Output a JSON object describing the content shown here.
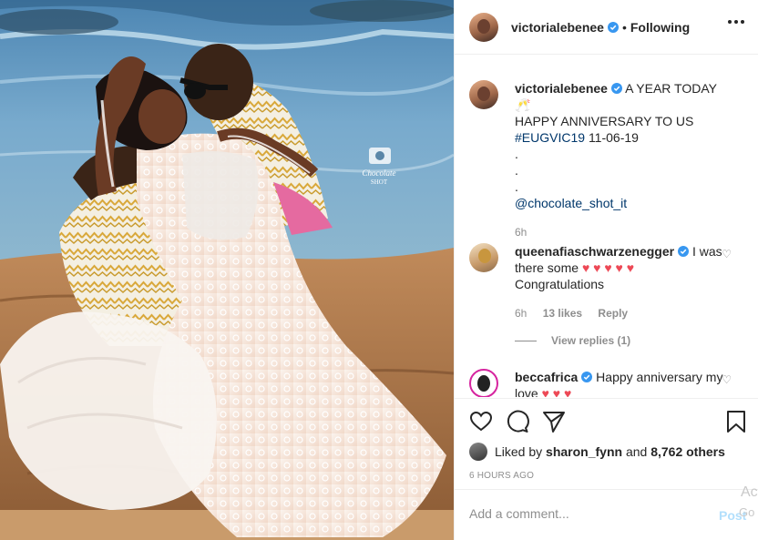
{
  "post": {
    "username": "victorialebenee",
    "follow_status": "Following",
    "separator": "•"
  },
  "caption": {
    "username": "victorialebenee",
    "line1": "A YEAR TODAY 🥂",
    "line2": "HAPPY ANNIVERSARY TO US",
    "hashtag": "#EUGVIC19",
    "date": "11-06-19",
    "dot1": ".",
    "dot2": ".",
    "dot3": ".",
    "mention": "@chocolate_shot_it",
    "time": "6h"
  },
  "comments": [
    {
      "username": "queenafiaschwarzenegger",
      "text_before": "I was there some",
      "hearts": "♥ ♥ ♥ ♥ ♥",
      "text_after": "Congratulations",
      "time": "6h",
      "likes": "13 likes",
      "reply": "Reply"
    },
    {
      "username": "beccafrica",
      "text": "Happy anniversary my love",
      "hearts": "♥ ♥ ♥"
    }
  ],
  "view_replies": "View replies (1)",
  "likes": {
    "prefix": "Liked by",
    "user": "sharon_fynn",
    "and": "and",
    "count": "8,762 others"
  },
  "timestamp": "6 HOURS AGO",
  "add_comment": {
    "placeholder": "Add a comment...",
    "post": "Post"
  },
  "watermark": {
    "line1": "Ac",
    "line2": "Go"
  },
  "photo_watermark": {
    "line1": "Chocolate",
    "line2": "SHOT"
  },
  "colors": {
    "link": "#00376b",
    "verified": "#3897f0",
    "heart": "#ed4956",
    "post_disabled": "#b2dffc"
  }
}
